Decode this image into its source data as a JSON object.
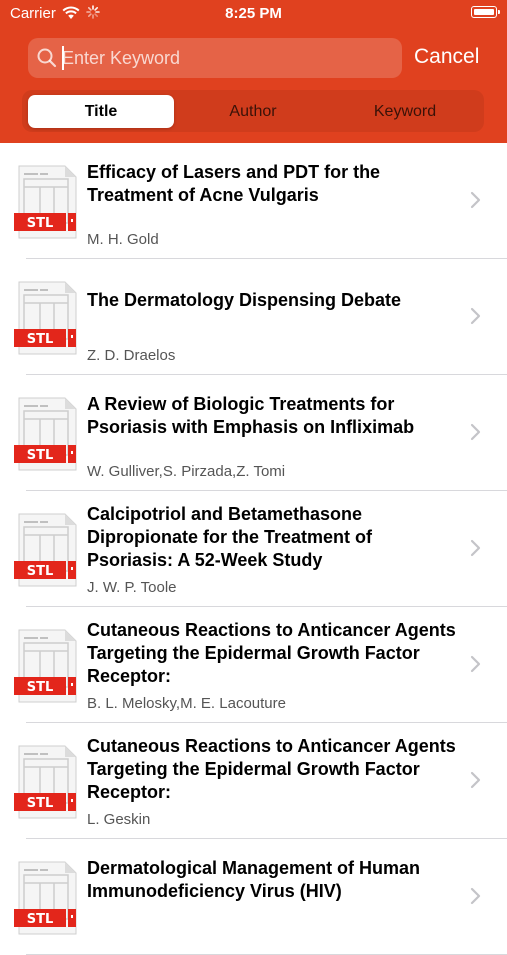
{
  "status_bar": {
    "carrier": "Carrier",
    "time": "8:25 PM"
  },
  "search": {
    "placeholder": "Enter Keyword",
    "value": "",
    "cancel_label": "Cancel"
  },
  "segments": [
    {
      "label": "Title",
      "selected": true
    },
    {
      "label": "Author",
      "selected": false
    },
    {
      "label": "Keyword",
      "selected": false
    }
  ],
  "doc_icon_label": "STL",
  "colors": {
    "header": "#e0411f",
    "stl_badge": "#e3261b"
  },
  "results": [
    {
      "title": " Efficacy of Lasers and PDT for the Treatment of Acne Vulgaris",
      "authors": "M. H. Gold"
    },
    {
      "title": " The Dermatology Dispensing Debate",
      "authors": "Z. D. Draelos"
    },
    {
      "title": " A Review of Biologic Treatments for Psoriasis with Emphasis on Infliximab",
      "authors": "W. Gulliver,S. Pirzada,Z. Tomi"
    },
    {
      "title": " Calcipotriol and Betamethasone Dipropionate for the Treatment of Psoriasis: A 52-Week Study",
      "authors": "J. W. P. Toole"
    },
    {
      "title": " Cutaneous Reactions to Anticancer Agents Targeting the Epidermal Growth Factor Receptor:",
      "authors": "B. L. Melosky,M. E. Lacouture"
    },
    {
      "title": " Cutaneous Reactions to Anticancer Agents Targeting the Epidermal Growth Factor Receptor:",
      "authors": "L. Geskin"
    },
    {
      "title": " Dermatological Management of Human Immunodeficiency Virus (HIV)",
      "authors": ""
    }
  ]
}
